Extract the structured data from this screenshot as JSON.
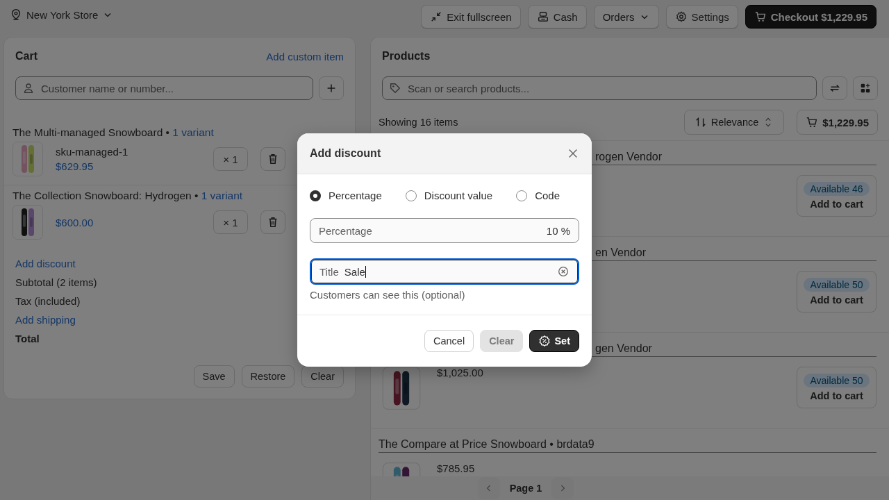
{
  "location": {
    "label": "New York Store"
  },
  "toolbar": [
    {
      "label": "Exit fullscreen",
      "kind": "exit"
    },
    {
      "label": "Cash",
      "kind": "cash"
    },
    {
      "label": "Orders",
      "kind": "menu"
    },
    {
      "label": "Settings",
      "kind": "settings"
    },
    {
      "label": "Checkout $1,229.95",
      "kind": "checkout"
    }
  ],
  "cart": {
    "title": "Cart",
    "add_custom": "Add custom item",
    "customer_placeholder": "Customer name or number...",
    "items": [
      {
        "title": "The Multi-managed Snowboard",
        "separator": "•",
        "variant": "1 variant",
        "sku": "sku-managed-1",
        "price": "$629.95",
        "qty": "× 1"
      },
      {
        "title": "The Collection Snowboard: Hydrogen",
        "separator": "•",
        "variant": "1 variant",
        "price": "$600.00",
        "qty": "× 1"
      }
    ],
    "summary": [
      {
        "label": "Add discount",
        "kind": "link"
      },
      {
        "label": "Subtotal (2 items)",
        "kind": "text"
      },
      {
        "label": "Tax (included)",
        "kind": "text"
      },
      {
        "label": "Add shipping",
        "kind": "link"
      },
      {
        "label": "Total",
        "kind": "total"
      }
    ],
    "actions": [
      "Save",
      "Restore",
      "Clear"
    ]
  },
  "products": {
    "title": "Products",
    "search_placeholder": "Scan or search products...",
    "count": "Showing 16 items",
    "sort": "Relevance",
    "cart_total": "$1,229.95",
    "items": [
      {
        "title": "rogen Vendor",
        "covered": true,
        "available": "Available 46",
        "add": "Add to cart"
      },
      {
        "title": "en Vendor",
        "covered": true,
        "available": "Available 50",
        "add": "Add to cart"
      },
      {
        "title": "gen Vendor",
        "covered": true,
        "price": "$1,025.00",
        "available": "Available 50",
        "add": "Add to cart"
      },
      {
        "title": "The Compare at Price Snowboard • brdata9",
        "price": "$785.95"
      }
    ],
    "pagination": {
      "page": "Page 1",
      "prev_disabled": true,
      "next_disabled": true
    }
  },
  "dialog": {
    "title": "Add discount",
    "options": [
      {
        "label": "Percentage",
        "selected": true
      },
      {
        "label": "Discount value",
        "selected": false
      },
      {
        "label": "Code",
        "selected": false
      }
    ],
    "amount": {
      "label": "Percentage",
      "value": "10",
      "suffix": "%"
    },
    "title_field": {
      "label": "Title",
      "value": "Sale",
      "focused": true
    },
    "help": "Customers can see this (optional)",
    "buttons": [
      {
        "label": "Cancel",
        "kind": "secondary",
        "disabled": false
      },
      {
        "label": "Clear",
        "kind": "secondary",
        "disabled": true
      },
      {
        "label": "Set",
        "kind": "primary",
        "disabled": false
      }
    ]
  }
}
